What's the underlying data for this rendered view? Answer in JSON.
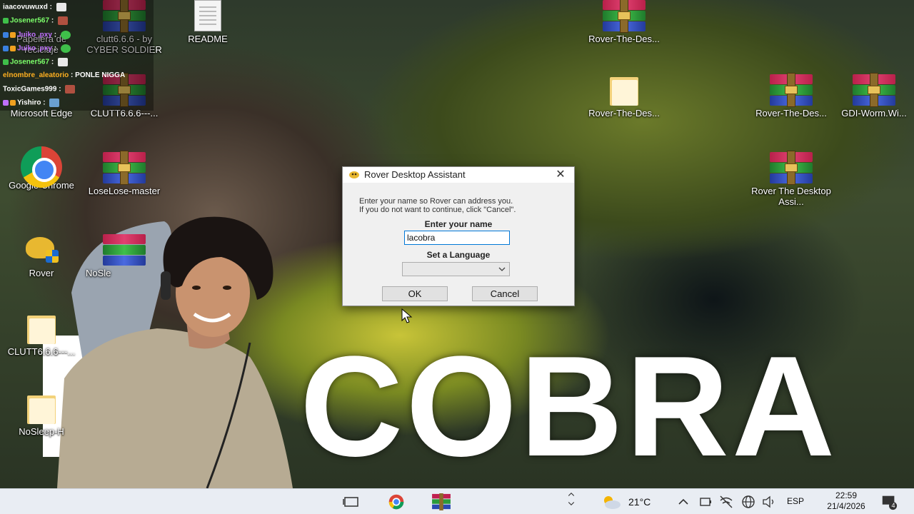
{
  "wallpaper": {
    "caption": "COBRA"
  },
  "chat": {
    "messages": [
      {
        "user": "iaacovuwuxd",
        "text": "",
        "color": "#ffffff"
      },
      {
        "user": "Josener567",
        "text": "",
        "color": "#7cff6a"
      },
      {
        "user": "Juiko_pxy",
        "text": "",
        "color": "#c070ff"
      },
      {
        "user": "Juiko_pxy",
        "text": "",
        "color": "#c070ff"
      },
      {
        "user": "Josener567",
        "text": "",
        "color": "#7cff6a"
      },
      {
        "user": "elnombre_aleatorio",
        "text": "PONLE NIGGA",
        "color": "#ffb020"
      },
      {
        "user": "ToxicGames999",
        "text": "",
        "color": "#ffffff"
      },
      {
        "user": "Yishiro",
        "text": "",
        "color": "#ffffff"
      }
    ]
  },
  "desktop": {
    "icons": [
      {
        "label": "Papelera de reciclaje"
      },
      {
        "label": "clutt6.6.6 - by CYBER SOLDIER"
      },
      {
        "label": "README"
      },
      {
        "label": "Rover-The-Des..."
      },
      {
        "label": "Microsoft Edge"
      },
      {
        "label": "CLUTT6.6.6---..."
      },
      {
        "label": "Rover-The-Des..."
      },
      {
        "label": "Rover-The-Des..."
      },
      {
        "label": "GDI-Worm.Wi..."
      },
      {
        "label": "Google Chrome"
      },
      {
        "label": "LoseLose-master"
      },
      {
        "label": "Rover The Desktop Assi..."
      },
      {
        "label": "Rover"
      },
      {
        "label": "NoSle"
      },
      {
        "label": "CLUTT6.6.6---..."
      },
      {
        "label": "NoSleep-H"
      }
    ]
  },
  "dialog": {
    "title": "Rover Desktop Assistant",
    "close_glyph": "✕",
    "message_line1": "Enter your name so Rover can address you.",
    "message_line2": "If you do not want to continue, click \"Cancel\".",
    "name_label": "Enter your name",
    "name_value": "lacobra",
    "language_label": "Set a Language",
    "language_value": "",
    "ok_label": "OK",
    "cancel_label": "Cancel"
  },
  "taskbar": {
    "weather": "21°C",
    "language": "ESP",
    "time": "22:59",
    "date": "21/4/2026",
    "notification_count": "4"
  }
}
